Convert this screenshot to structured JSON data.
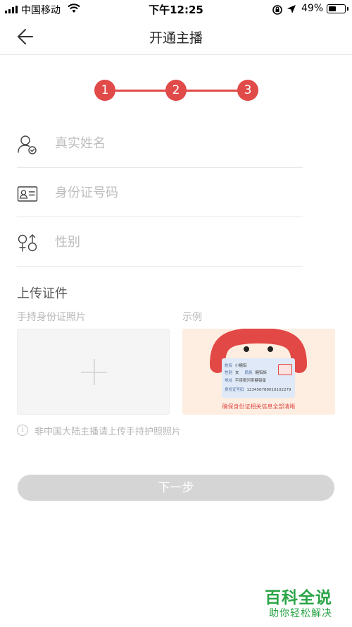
{
  "status_bar": {
    "carrier": "中国移动",
    "time": "下午12:25",
    "battery_text": "49%",
    "battery_level": 0.49
  },
  "nav": {
    "title": "开通主播"
  },
  "stepper": {
    "steps": [
      "1",
      "2",
      "3"
    ],
    "accent_color": "#e04a48"
  },
  "form": {
    "name_placeholder": "真实姓名",
    "id_placeholder": "身份证号码",
    "gender_placeholder": "性别"
  },
  "upload": {
    "section_title": "上传证件",
    "handheld_label": "手持身份证照片",
    "example_label": "示例",
    "example_card": {
      "name_label": "姓名",
      "name_value": "小糖铝",
      "gender_label": "性别",
      "gender_value": "女",
      "ethnicity_label": "民族",
      "ethnicity_value": "糖铝族",
      "address_label": "地址",
      "address_value": "宇宙银河系糖铝星",
      "id_label": "身份证号码",
      "id_value": "123456789010102279",
      "caption": "确保身份证相关信息全部清晰"
    }
  },
  "notice": {
    "text": "非中国大陆主播请上传手持护照照片"
  },
  "next_button": {
    "label": "下一步"
  },
  "watermark": {
    "title": "百科全说",
    "subtitle": "助你轻松解决"
  }
}
